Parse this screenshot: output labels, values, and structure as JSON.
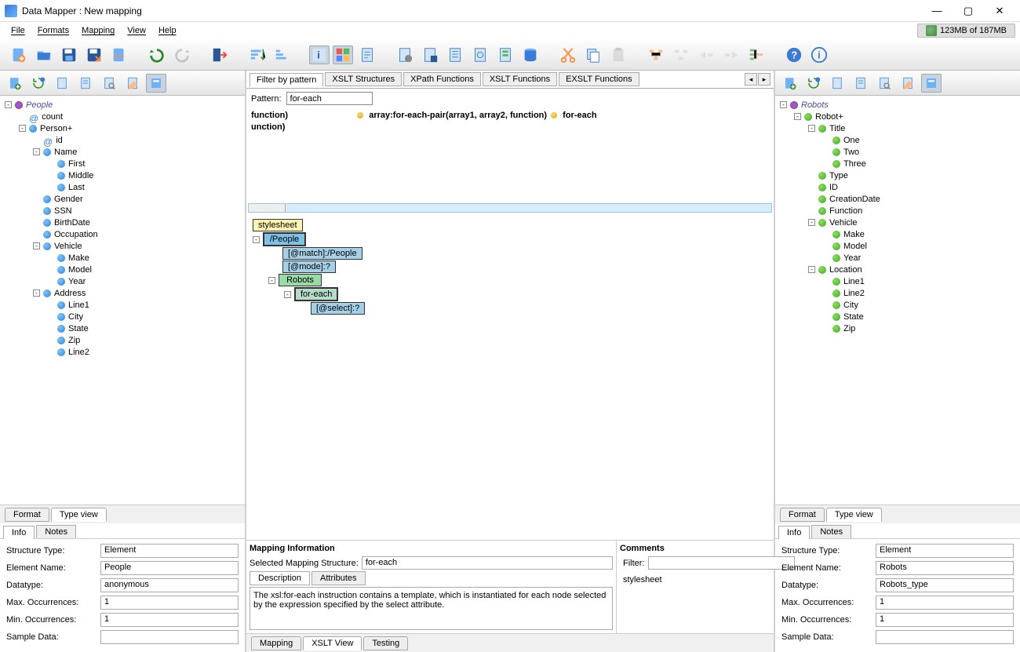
{
  "title": "Data Mapper : New mapping",
  "menubar": [
    "File",
    "Formats",
    "Mapping",
    "View",
    "Help"
  ],
  "memory": "123MB of 187MB",
  "leftTree": {
    "root": "People",
    "nodes": [
      {
        "lvl": 0,
        "type": "root",
        "tog": "-",
        "label": "People"
      },
      {
        "lvl": 1,
        "type": "attr",
        "label": "count"
      },
      {
        "lvl": 1,
        "type": "blue",
        "tog": "-",
        "label": "Person+"
      },
      {
        "lvl": 2,
        "type": "attr",
        "label": "id"
      },
      {
        "lvl": 2,
        "type": "blue",
        "tog": "-",
        "label": "Name"
      },
      {
        "lvl": 3,
        "type": "blue",
        "label": "First"
      },
      {
        "lvl": 3,
        "type": "blue",
        "label": "Middle"
      },
      {
        "lvl": 3,
        "type": "blue",
        "label": "Last"
      },
      {
        "lvl": 2,
        "type": "blue",
        "label": "Gender"
      },
      {
        "lvl": 2,
        "type": "blue",
        "label": "SSN"
      },
      {
        "lvl": 2,
        "type": "blue",
        "label": "BirthDate"
      },
      {
        "lvl": 2,
        "type": "blue",
        "label": "Occupation"
      },
      {
        "lvl": 2,
        "type": "blue",
        "tog": "-",
        "label": "Vehicle"
      },
      {
        "lvl": 3,
        "type": "blue",
        "label": "Make"
      },
      {
        "lvl": 3,
        "type": "blue",
        "label": "Model"
      },
      {
        "lvl": 3,
        "type": "blue",
        "label": "Year"
      },
      {
        "lvl": 2,
        "type": "blue",
        "tog": "-",
        "label": "Address"
      },
      {
        "lvl": 3,
        "type": "blue",
        "label": "Line1"
      },
      {
        "lvl": 3,
        "type": "blue",
        "label": "City"
      },
      {
        "lvl": 3,
        "type": "blue",
        "label": "State"
      },
      {
        "lvl": 3,
        "type": "blue",
        "label": "Zip"
      },
      {
        "lvl": 3,
        "type": "blue",
        "label": "Line2"
      }
    ]
  },
  "rightTree": {
    "root": "Robots",
    "nodes": [
      {
        "lvl": 0,
        "type": "root",
        "tog": "-",
        "label": "Robots"
      },
      {
        "lvl": 1,
        "type": "green",
        "tog": "-",
        "label": "Robot+"
      },
      {
        "lvl": 2,
        "type": "green",
        "tog": "-",
        "label": "Title"
      },
      {
        "lvl": 3,
        "type": "green",
        "label": "One"
      },
      {
        "lvl": 3,
        "type": "green",
        "label": "Two"
      },
      {
        "lvl": 3,
        "type": "green",
        "label": "Three"
      },
      {
        "lvl": 2,
        "type": "green",
        "label": "Type"
      },
      {
        "lvl": 2,
        "type": "green",
        "label": "ID"
      },
      {
        "lvl": 2,
        "type": "green",
        "label": "CreationDate"
      },
      {
        "lvl": 2,
        "type": "green",
        "label": "Function"
      },
      {
        "lvl": 2,
        "type": "green",
        "tog": "-",
        "label": "Vehicle"
      },
      {
        "lvl": 3,
        "type": "green",
        "label": "Make"
      },
      {
        "lvl": 3,
        "type": "green",
        "label": "Model"
      },
      {
        "lvl": 3,
        "type": "green",
        "label": "Year"
      },
      {
        "lvl": 2,
        "type": "green",
        "tog": "-",
        "label": "Location"
      },
      {
        "lvl": 3,
        "type": "green",
        "label": "Line1"
      },
      {
        "lvl": 3,
        "type": "green",
        "label": "Line2"
      },
      {
        "lvl": 3,
        "type": "green",
        "label": "City"
      },
      {
        "lvl": 3,
        "type": "green",
        "label": "State"
      },
      {
        "lvl": 3,
        "type": "green",
        "label": "Zip"
      }
    ]
  },
  "bottomTabs": {
    "format": "Format",
    "typeview": "Type view"
  },
  "infoTabs": {
    "info": "Info",
    "notes": "Notes"
  },
  "leftInfo": {
    "labels": {
      "structType": "Structure Type:",
      "elemName": "Element Name:",
      "datatype": "Datatype:",
      "maxOcc": "Max. Occurrences:",
      "minOcc": "Min. Occurrences:",
      "sample": "Sample Data:"
    },
    "values": {
      "structType": "Element",
      "elemName": "People",
      "datatype": "anonymous",
      "maxOcc": "1",
      "minOcc": "1",
      "sample": ""
    }
  },
  "rightInfo": {
    "values": {
      "structType": "Element",
      "elemName": "Robots",
      "datatype": "Robots_type",
      "maxOcc": "1",
      "minOcc": "1",
      "sample": ""
    }
  },
  "centerTabs": [
    "Filter by pattern",
    "XSLT Structures",
    "XPath Functions",
    "XSLT Functions",
    "EXSLT Functions"
  ],
  "pattern": {
    "label": "Pattern:",
    "value": "for-each"
  },
  "hints": {
    "line1a": "function)",
    "line1b": "array:for-each-pair(array1, array2, function)",
    "line1c": "for-each",
    "line2": "unction)"
  },
  "mapNodes": {
    "stylesheet": "stylesheet",
    "people": "/People",
    "match": "[@match]:/People",
    "mode": "[@mode]:?",
    "robots": "Robots",
    "foreach": "for-each",
    "select": "[@select]:?"
  },
  "mappingInfo": {
    "title": "Mapping Information",
    "selLabel": "Selected Mapping Structure:",
    "selValue": "for-each",
    "descTab": "Description",
    "attrTab": "Attributes",
    "description": "The xsl:for-each instruction contains a template, which is instantiated for each node selected by the expression specified by the select attribute."
  },
  "comments": {
    "title": "Comments",
    "filterLabel": "Filter:",
    "filterValue": "",
    "items": [
      "stylesheet"
    ]
  },
  "centerFooterTabs": [
    "Mapping",
    "XSLT View",
    "Testing"
  ]
}
